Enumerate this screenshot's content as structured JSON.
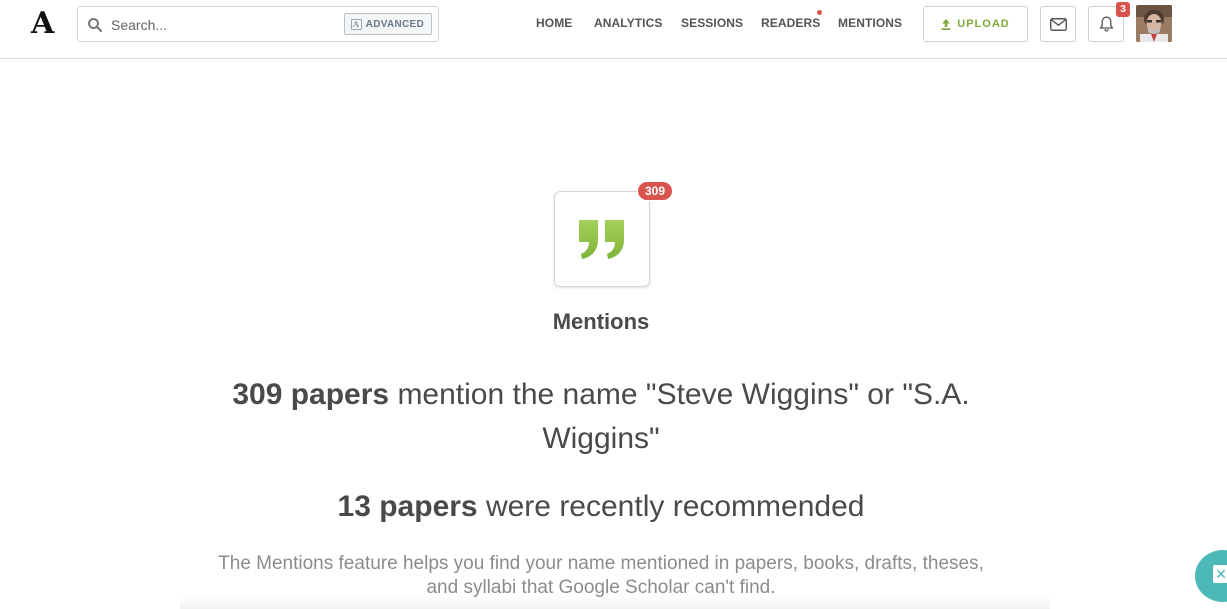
{
  "header": {
    "logo": "A",
    "search": {
      "placeholder": "Search...",
      "advanced_label": "ADVANCED"
    },
    "nav": [
      {
        "label": "HOME"
      },
      {
        "label": "ANALYTICS"
      },
      {
        "label": "SESSIONS"
      },
      {
        "label": "READERS",
        "has_dot": true
      },
      {
        "label": "MENTIONS"
      }
    ],
    "upload_label": "UPLOAD",
    "notifications_count": "3",
    "icons": {
      "search": "search-icon",
      "mail": "envelope-icon",
      "bell": "bell-icon",
      "upload": "upload-icon"
    }
  },
  "main": {
    "tile_badge": "309",
    "tile_icon": "quote-icon",
    "title": "Mentions",
    "mentions_count": "309 papers",
    "mentions_text": " mention the name \"Steve Wiggins\" or \"S.A. Wiggins\"",
    "recommended_count": "13 papers",
    "recommended_text": " were recently recommended",
    "description": "The Mentions feature helps you find your name mentioned in papers, books, drafts, theses, and syllabi that Google Scholar can't find."
  },
  "colors": {
    "accent_green": "#7eaa3b",
    "badge_red": "#d9534f",
    "chat_teal": "#4cb8b8"
  }
}
